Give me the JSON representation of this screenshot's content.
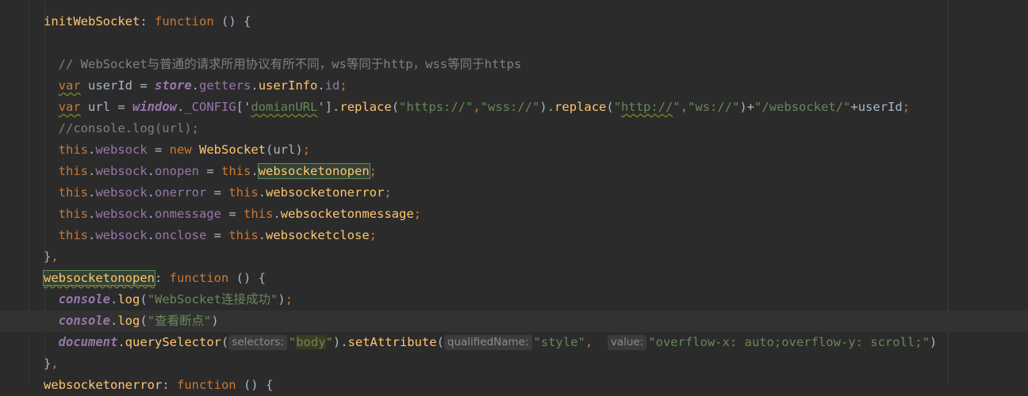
{
  "editor": {
    "lines": [
      {
        "tokens": [
          {
            "t": "initWebSocket",
            "c": "c-prop"
          },
          {
            "t": ": ",
            "c": "c-punc"
          },
          {
            "t": "function",
            "c": "c-kw"
          },
          {
            "t": " () {",
            "c": "c-punc"
          }
        ]
      },
      {
        "tokens": []
      },
      {
        "tokens": [
          {
            "t": "  // WebSocket与普通的请求所用协议有所不同，ws等同于http，wss等同于https",
            "c": "c-comment"
          }
        ]
      },
      {
        "tokens": [
          {
            "t": "  ",
            "c": "c-punc"
          },
          {
            "t": "var",
            "c": "c-var"
          },
          {
            "t": " userId = ",
            "c": "c-ident"
          },
          {
            "t": "store",
            "c": "c-global"
          },
          {
            "t": ".",
            "c": "c-punc"
          },
          {
            "t": "getters",
            "c": "c-field"
          },
          {
            "t": ".",
            "c": "c-punc"
          },
          {
            "t": "userInfo",
            "c": "c-method"
          },
          {
            "t": ".",
            "c": "c-punc"
          },
          {
            "t": "id",
            "c": "c-field"
          },
          {
            "t": ";",
            "c": "c-kw"
          }
        ]
      },
      {
        "tokens": [
          {
            "t": "  ",
            "c": "c-punc"
          },
          {
            "t": "var",
            "c": "c-var"
          },
          {
            "t": " url = ",
            "c": "c-ident"
          },
          {
            "t": "window",
            "c": "c-global"
          },
          {
            "t": ".",
            "c": "c-punc"
          },
          {
            "t": "_CONFIG",
            "c": "c-field"
          },
          {
            "t": "['",
            "c": "c-punc"
          },
          {
            "t": "domianURL",
            "c": "c-str-typo"
          },
          {
            "t": "']",
            "c": "c-punc"
          },
          {
            "t": ".",
            "c": "c-punc"
          },
          {
            "t": "replace",
            "c": "c-method"
          },
          {
            "t": "(",
            "c": "c-punc"
          },
          {
            "t": "\"https://\"",
            "c": "c-str"
          },
          {
            "t": ",",
            "c": "c-kw"
          },
          {
            "t": "\"wss://\"",
            "c": "c-str"
          },
          {
            "t": ").",
            "c": "c-punc"
          },
          {
            "t": "replace",
            "c": "c-method"
          },
          {
            "t": "(",
            "c": "c-punc"
          },
          {
            "t": "\"",
            "c": "c-str"
          },
          {
            "t": "http://",
            "c": "c-str-typo"
          },
          {
            "t": "\"",
            "c": "c-str"
          },
          {
            "t": ",",
            "c": "c-kw"
          },
          {
            "t": "\"ws://\"",
            "c": "c-str"
          },
          {
            "t": ")+",
            "c": "c-punc"
          },
          {
            "t": "\"/websocket/\"",
            "c": "c-str"
          },
          {
            "t": "+userId",
            "c": "c-ident"
          },
          {
            "t": ";",
            "c": "c-kw"
          }
        ]
      },
      {
        "tokens": [
          {
            "t": "  //console.log(url);",
            "c": "c-comment"
          }
        ]
      },
      {
        "tokens": [
          {
            "t": "  ",
            "c": "c-punc"
          },
          {
            "t": "this",
            "c": "c-this"
          },
          {
            "t": ".",
            "c": "c-punc"
          },
          {
            "t": "websock",
            "c": "c-field"
          },
          {
            "t": " = ",
            "c": "c-ident"
          },
          {
            "t": "new",
            "c": "c-kw"
          },
          {
            "t": " ",
            "c": "c-punc"
          },
          {
            "t": "WebSocket",
            "c": "c-class"
          },
          {
            "t": "(url)",
            "c": "c-ident"
          },
          {
            "t": ";",
            "c": "c-kw"
          }
        ]
      },
      {
        "tokens": [
          {
            "t": "  ",
            "c": "c-punc"
          },
          {
            "t": "this",
            "c": "c-this"
          },
          {
            "t": ".",
            "c": "c-punc"
          },
          {
            "t": "websock",
            "c": "c-field"
          },
          {
            "t": ".",
            "c": "c-punc"
          },
          {
            "t": "onopen",
            "c": "c-field"
          },
          {
            "t": " = ",
            "c": "c-ident"
          },
          {
            "t": "this",
            "c": "c-this"
          },
          {
            "t": ".",
            "c": "c-punc"
          },
          {
            "t": "websocketonopen",
            "c": "c-hl"
          },
          {
            "t": ";",
            "c": "c-kw"
          }
        ]
      },
      {
        "tokens": [
          {
            "t": "  ",
            "c": "c-punc"
          },
          {
            "t": "this",
            "c": "c-this"
          },
          {
            "t": ".",
            "c": "c-punc"
          },
          {
            "t": "websock",
            "c": "c-field"
          },
          {
            "t": ".",
            "c": "c-punc"
          },
          {
            "t": "onerror",
            "c": "c-field"
          },
          {
            "t": " = ",
            "c": "c-ident"
          },
          {
            "t": "this",
            "c": "c-this"
          },
          {
            "t": ".",
            "c": "c-punc"
          },
          {
            "t": "websocketonerror",
            "c": "c-method"
          },
          {
            "t": ";",
            "c": "c-kw"
          }
        ]
      },
      {
        "tokens": [
          {
            "t": "  ",
            "c": "c-punc"
          },
          {
            "t": "this",
            "c": "c-this"
          },
          {
            "t": ".",
            "c": "c-punc"
          },
          {
            "t": "websock",
            "c": "c-field"
          },
          {
            "t": ".",
            "c": "c-punc"
          },
          {
            "t": "onmessage",
            "c": "c-field"
          },
          {
            "t": " = ",
            "c": "c-ident"
          },
          {
            "t": "this",
            "c": "c-this"
          },
          {
            "t": ".",
            "c": "c-punc"
          },
          {
            "t": "websocketonmessage",
            "c": "c-method"
          },
          {
            "t": ";",
            "c": "c-kw"
          }
        ]
      },
      {
        "tokens": [
          {
            "t": "  ",
            "c": "c-punc"
          },
          {
            "t": "this",
            "c": "c-this"
          },
          {
            "t": ".",
            "c": "c-punc"
          },
          {
            "t": "websock",
            "c": "c-field"
          },
          {
            "t": ".",
            "c": "c-punc"
          },
          {
            "t": "onclose",
            "c": "c-field"
          },
          {
            "t": " = ",
            "c": "c-ident"
          },
          {
            "t": "this",
            "c": "c-this"
          },
          {
            "t": ".",
            "c": "c-punc"
          },
          {
            "t": "websocketclose",
            "c": "c-method"
          },
          {
            "t": ";",
            "c": "c-kw"
          }
        ]
      },
      {
        "tokens": [
          {
            "t": "}",
            "c": "c-punc"
          },
          {
            "t": ",",
            "c": "c-kw"
          }
        ]
      },
      {
        "tokens": [
          {
            "t": "websocketonopen",
            "c": "c-hl-under"
          },
          {
            "t": ": ",
            "c": "c-punc"
          },
          {
            "t": "function",
            "c": "c-kw"
          },
          {
            "t": " () {",
            "c": "c-punc"
          }
        ]
      },
      {
        "tokens": [
          {
            "t": "  ",
            "c": "c-punc"
          },
          {
            "t": "console",
            "c": "c-global"
          },
          {
            "t": ".",
            "c": "c-punc"
          },
          {
            "t": "log",
            "c": "c-method"
          },
          {
            "t": "(",
            "c": "c-punc"
          },
          {
            "t": "\"WebSocket连接成功\"",
            "c": "c-str"
          },
          {
            "t": ")",
            "c": "c-punc"
          },
          {
            "t": ";",
            "c": "c-kw"
          }
        ]
      },
      {
        "tokens": [
          {
            "t": "  ",
            "c": "c-punc"
          },
          {
            "t": "console",
            "c": "c-global"
          },
          {
            "t": ".",
            "c": "c-punc"
          },
          {
            "t": "log",
            "c": "c-method"
          },
          {
            "t": "(",
            "c": "c-punc"
          },
          {
            "t": "\"查看断点\"",
            "c": "c-str"
          },
          {
            "t": ")",
            "c": "c-punc"
          }
        ],
        "current": true
      },
      {
        "tokens": [
          {
            "t": "  ",
            "c": "c-punc"
          },
          {
            "t": "document",
            "c": "c-global"
          },
          {
            "t": ".",
            "c": "c-punc"
          },
          {
            "t": "querySelector",
            "c": "c-method"
          },
          {
            "t": "(",
            "c": "c-punc"
          },
          {
            "hint": "selectors:"
          },
          {
            "t": "\"",
            "c": "c-str"
          },
          {
            "t": "body",
            "c": "c-str-hl"
          },
          {
            "t": "\"",
            "c": "c-str"
          },
          {
            "t": ").",
            "c": "c-punc"
          },
          {
            "t": "setAttribute",
            "c": "c-method"
          },
          {
            "t": "(",
            "c": "c-punc"
          },
          {
            "hint": "qualifiedName:"
          },
          {
            "t": "\"style\"",
            "c": "c-str"
          },
          {
            "t": ",  ",
            "c": "c-kw"
          },
          {
            "hint": "value:"
          },
          {
            "t": "\"overflow-x: auto;overflow-y: scroll;\"",
            "c": "c-str"
          },
          {
            "t": ")",
            "c": "c-punc"
          }
        ]
      },
      {
        "tokens": [
          {
            "t": "}",
            "c": "c-punc"
          },
          {
            "t": ",",
            "c": "c-kw"
          }
        ]
      },
      {
        "tokens": [
          {
            "t": "websocketonerror",
            "c": "c-prop"
          },
          {
            "t": ": ",
            "c": "c-punc"
          },
          {
            "t": "function",
            "c": "c-kw"
          },
          {
            "t": " () {",
            "c": "c-punc"
          }
        ]
      }
    ]
  }
}
